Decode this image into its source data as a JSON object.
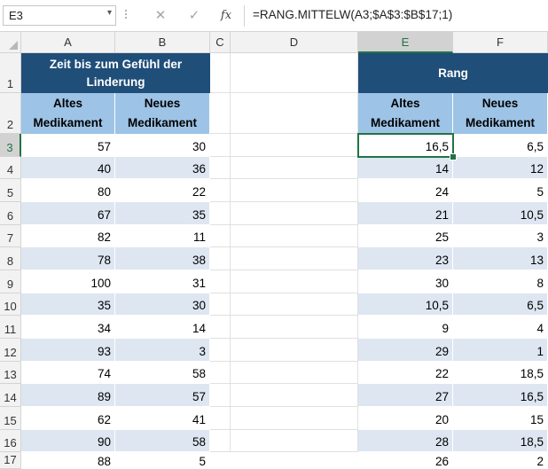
{
  "formula_bar": {
    "name_box": "E3",
    "cancel_icon": "✕",
    "enter_icon": "✓",
    "fx_label": "fx",
    "formula": "=RANG.MITTELW(A3;$A$3:$B$17;1)"
  },
  "columns": [
    "A",
    "B",
    "C",
    "D",
    "E",
    "F"
  ],
  "rows": [
    "1",
    "2",
    "3",
    "4",
    "5",
    "6",
    "7",
    "8",
    "9",
    "10",
    "11",
    "12",
    "13",
    "14",
    "15",
    "16",
    "17"
  ],
  "left_table": {
    "title_line1": "Zeit bis zum Gefühl der",
    "title_line2": "Linderung",
    "col_a_line1": "Altes",
    "col_a_line2": "Medikament",
    "col_b_line1": "Neues",
    "col_b_line2": "Medikament",
    "data": [
      [
        "57",
        "30"
      ],
      [
        "40",
        "36"
      ],
      [
        "80",
        "22"
      ],
      [
        "67",
        "35"
      ],
      [
        "82",
        "11"
      ],
      [
        "78",
        "38"
      ],
      [
        "100",
        "31"
      ],
      [
        "35",
        "30"
      ],
      [
        "34",
        "14"
      ],
      [
        "93",
        "3"
      ],
      [
        "74",
        "58"
      ],
      [
        "89",
        "57"
      ],
      [
        "62",
        "41"
      ],
      [
        "90",
        "58"
      ],
      [
        "88",
        "5"
      ]
    ]
  },
  "right_table": {
    "title": "Rang",
    "col_e_line1": "Altes",
    "col_e_line2": "Medikament",
    "col_f_line1": "Neues",
    "col_f_line2": "Medikament",
    "data": [
      [
        "16,5",
        "6,5"
      ],
      [
        "14",
        "12"
      ],
      [
        "24",
        "5"
      ],
      [
        "21",
        "10,5"
      ],
      [
        "25",
        "3"
      ],
      [
        "23",
        "13"
      ],
      [
        "30",
        "8"
      ],
      [
        "10,5",
        "6,5"
      ],
      [
        "9",
        "4"
      ],
      [
        "29",
        "1"
      ],
      [
        "22",
        "18,5"
      ],
      [
        "27",
        "16,5"
      ],
      [
        "20",
        "15"
      ],
      [
        "28",
        "18,5"
      ],
      [
        "26",
        "2"
      ]
    ]
  },
  "colors": {
    "header_dark": "#1f4e79",
    "header_light": "#9dc3e6",
    "band": "#dde6f1",
    "selection": "#217346"
  }
}
